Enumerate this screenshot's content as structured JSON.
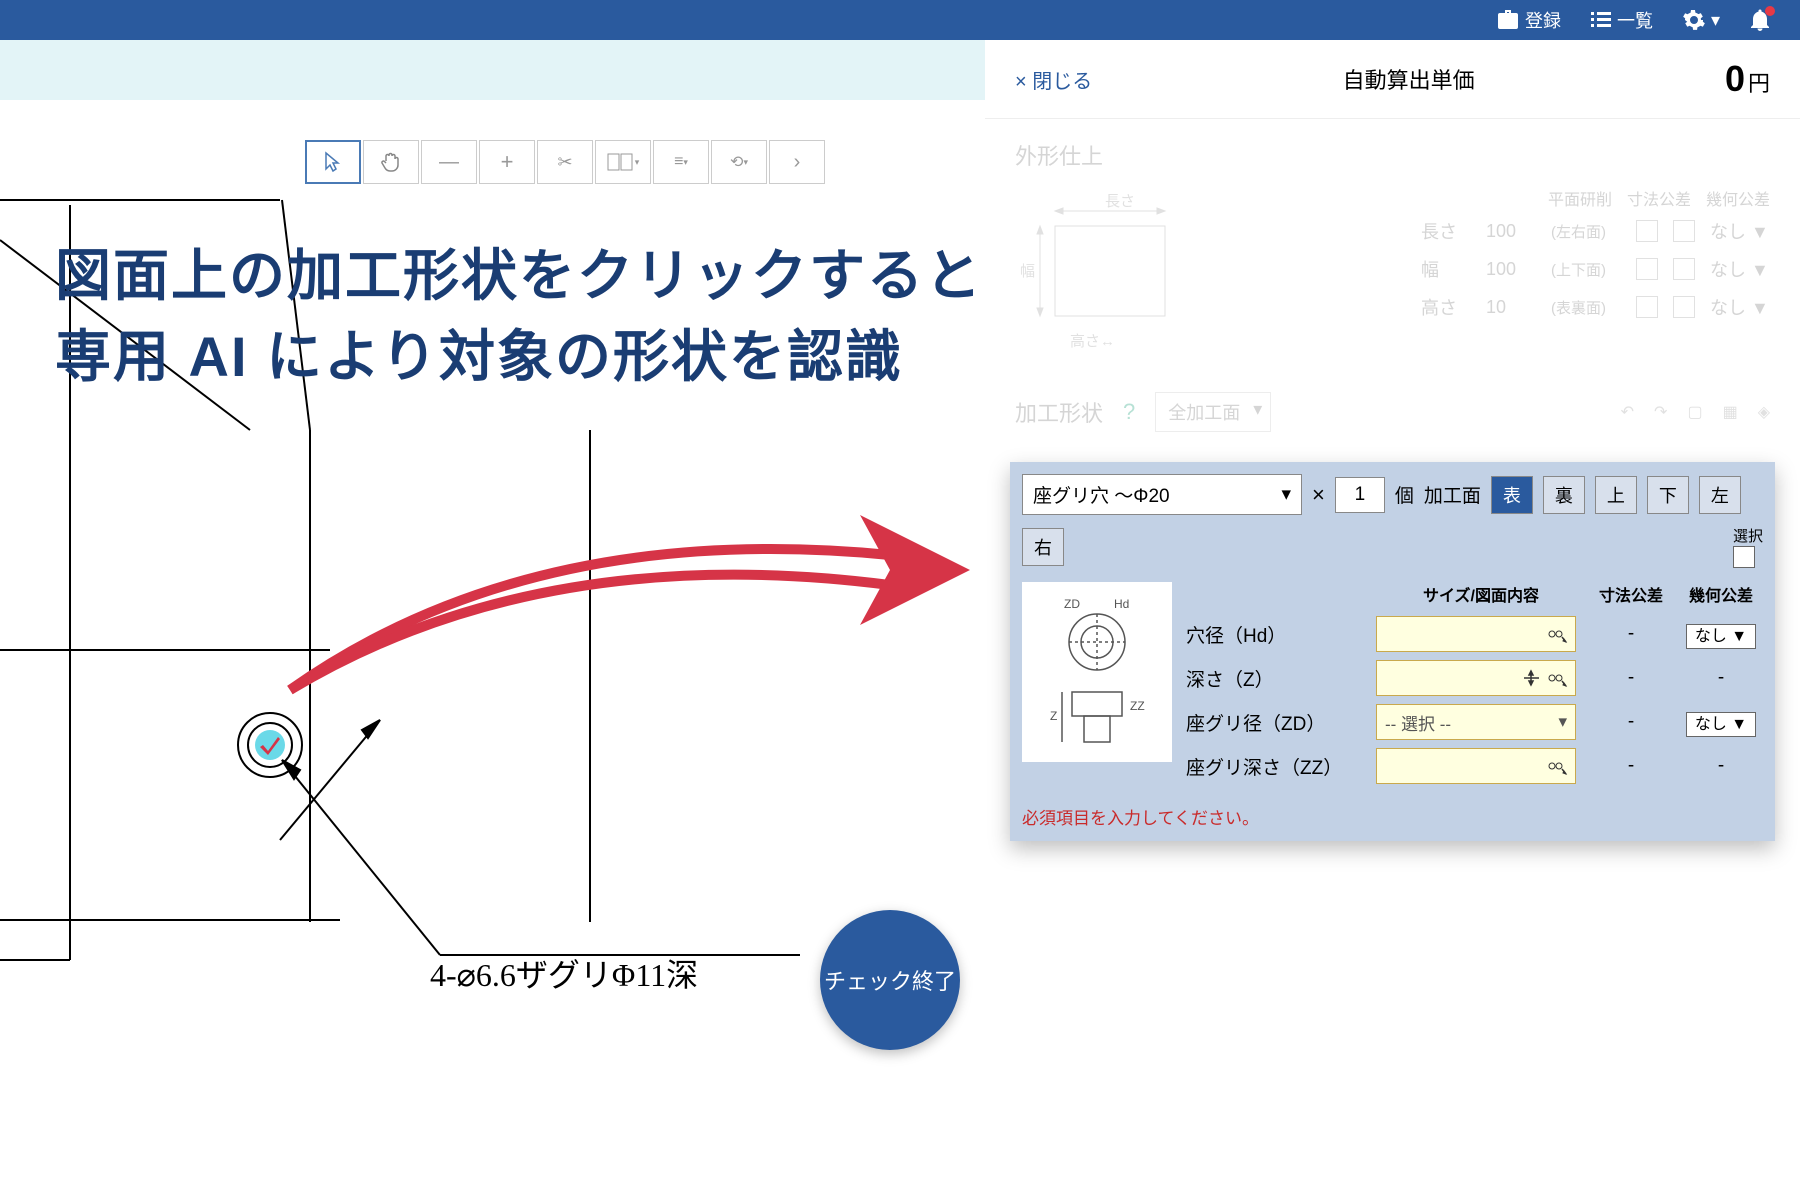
{
  "topbar": {
    "register": "登録",
    "list": "一覧"
  },
  "headline": {
    "line1": "図面上の加工形状をクリックすると",
    "line2": "専用 AI により対象の形状を認識"
  },
  "close": "× 閉じる",
  "price": {
    "label": "自動算出単価",
    "value": "0",
    "unit": "円"
  },
  "finish": {
    "title": "外形仕上",
    "length_label": "長さ",
    "width_label": "幅",
    "height_label": "高さ",
    "length_val": "100",
    "width_val": "100",
    "height_val": "10",
    "grinding": "平面研削",
    "dim_tol": "寸法公差",
    "geo_tol": "幾何公差",
    "face_lr": "(左右面)",
    "face_tb": "(上下面)",
    "face_fb": "(表裏面)",
    "none": "なし ▼"
  },
  "shapes": {
    "title": "加工形状",
    "all": "全加工面"
  },
  "feature": {
    "type": "座グリ穴 ～Φ20",
    "qty": "1",
    "unit": "個",
    "face_label": "加工面",
    "faces": [
      "表",
      "裏",
      "上",
      "下",
      "左",
      "右"
    ],
    "sel_label": "選択",
    "size_header": "サイズ/図面内容",
    "dim_tol": "寸法公差",
    "geo_tol": "幾何公差",
    "rows": [
      {
        "label": "穴径（Hd）",
        "dim": "-",
        "geo": "なし ▼"
      },
      {
        "label": "深さ（Z）",
        "dim": "-",
        "geo": "-"
      },
      {
        "label": "座グリ径（ZD）",
        "select": "-- 選択 --",
        "dim": "-",
        "geo": "なし ▼"
      },
      {
        "label": "座グリ深さ（ZZ）",
        "dim": "-",
        "geo": "-"
      }
    ],
    "error": "必須項目を入力してください。"
  },
  "check_done": "チェック終了",
  "drawing_label": "4-⌀6.6ザグリΦ11深"
}
